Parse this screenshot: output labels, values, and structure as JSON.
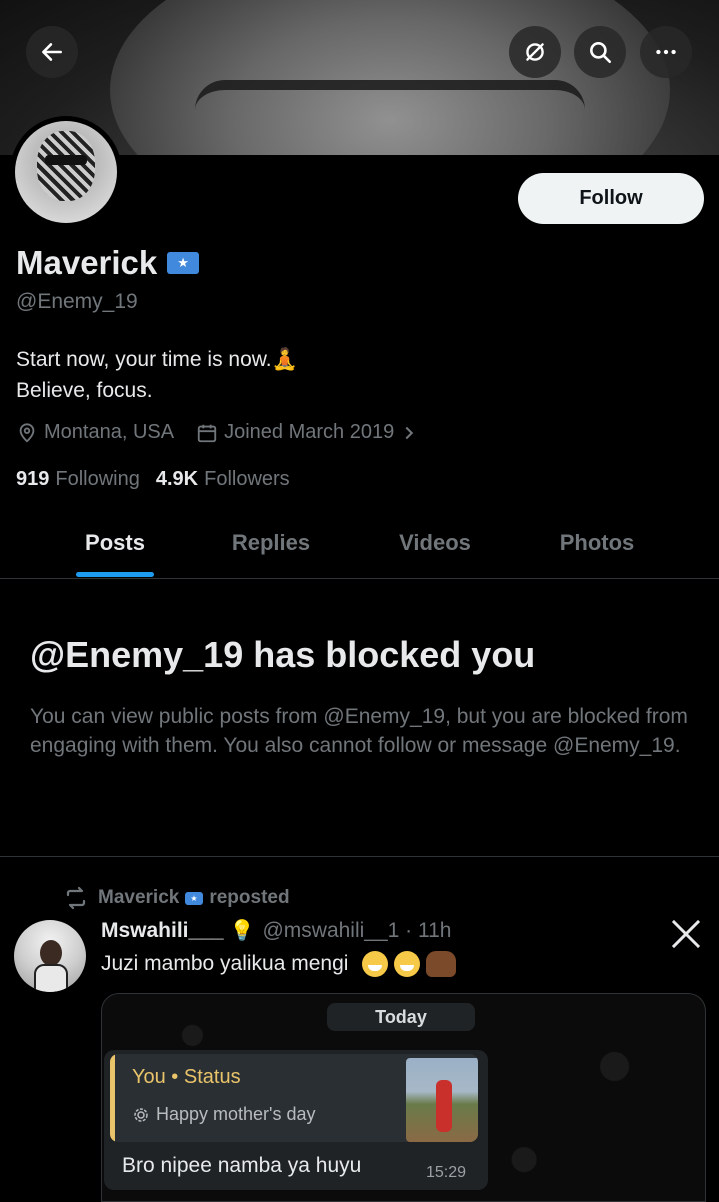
{
  "profile": {
    "name": "Maverick",
    "handle": "@Enemy_19",
    "bio_line1": "Start now, your time is now.🧘",
    "bio_line2": "Believe, focus.",
    "location": "Montana, USA",
    "joined": "Joined March 2019",
    "following_count": "919",
    "following_label": "Following",
    "followers_count": "4.9K",
    "followers_label": "Followers",
    "follow_label": "Follow"
  },
  "icons": {
    "back": "arrow-left-icon",
    "grok": "grok-icon",
    "search": "search-icon",
    "more": "more-icon",
    "location": "location-pin-icon",
    "calendar": "calendar-icon",
    "chevron": "chevron-right-icon",
    "repost": "repost-icon",
    "x_logo": "x-logo-icon",
    "flag": "somalia-flag-icon"
  },
  "tabs": [
    {
      "label": "Posts",
      "active": true
    },
    {
      "label": "Replies",
      "active": false
    },
    {
      "label": "Videos",
      "active": false
    },
    {
      "label": "Photos",
      "active": false
    }
  ],
  "blocked": {
    "title": "@Enemy_19 has blocked you",
    "text": "You can view public posts from @Enemy_19, but you are blocked from engaging with them. You also cannot follow or message @Enemy_19."
  },
  "post": {
    "repost_name": "Maverick",
    "repost_suffix": "reposted",
    "author": "Mswahili___",
    "author_emoji": "💡",
    "meta": "@mswahili__1 · 11h",
    "text": "Juzi mambo yalikua mengi",
    "media": {
      "date_pill": "Today",
      "quote_who": "You • Status",
      "quote_text": "Happy mother's day",
      "message": "Bro nipee namba ya huyu",
      "time": "15:29"
    }
  },
  "colors": {
    "background": "#000000",
    "text": "#e7e9ea",
    "muted": "#71767b",
    "accent": "#1d9bf0",
    "quote_accent": "#e9c46a"
  }
}
